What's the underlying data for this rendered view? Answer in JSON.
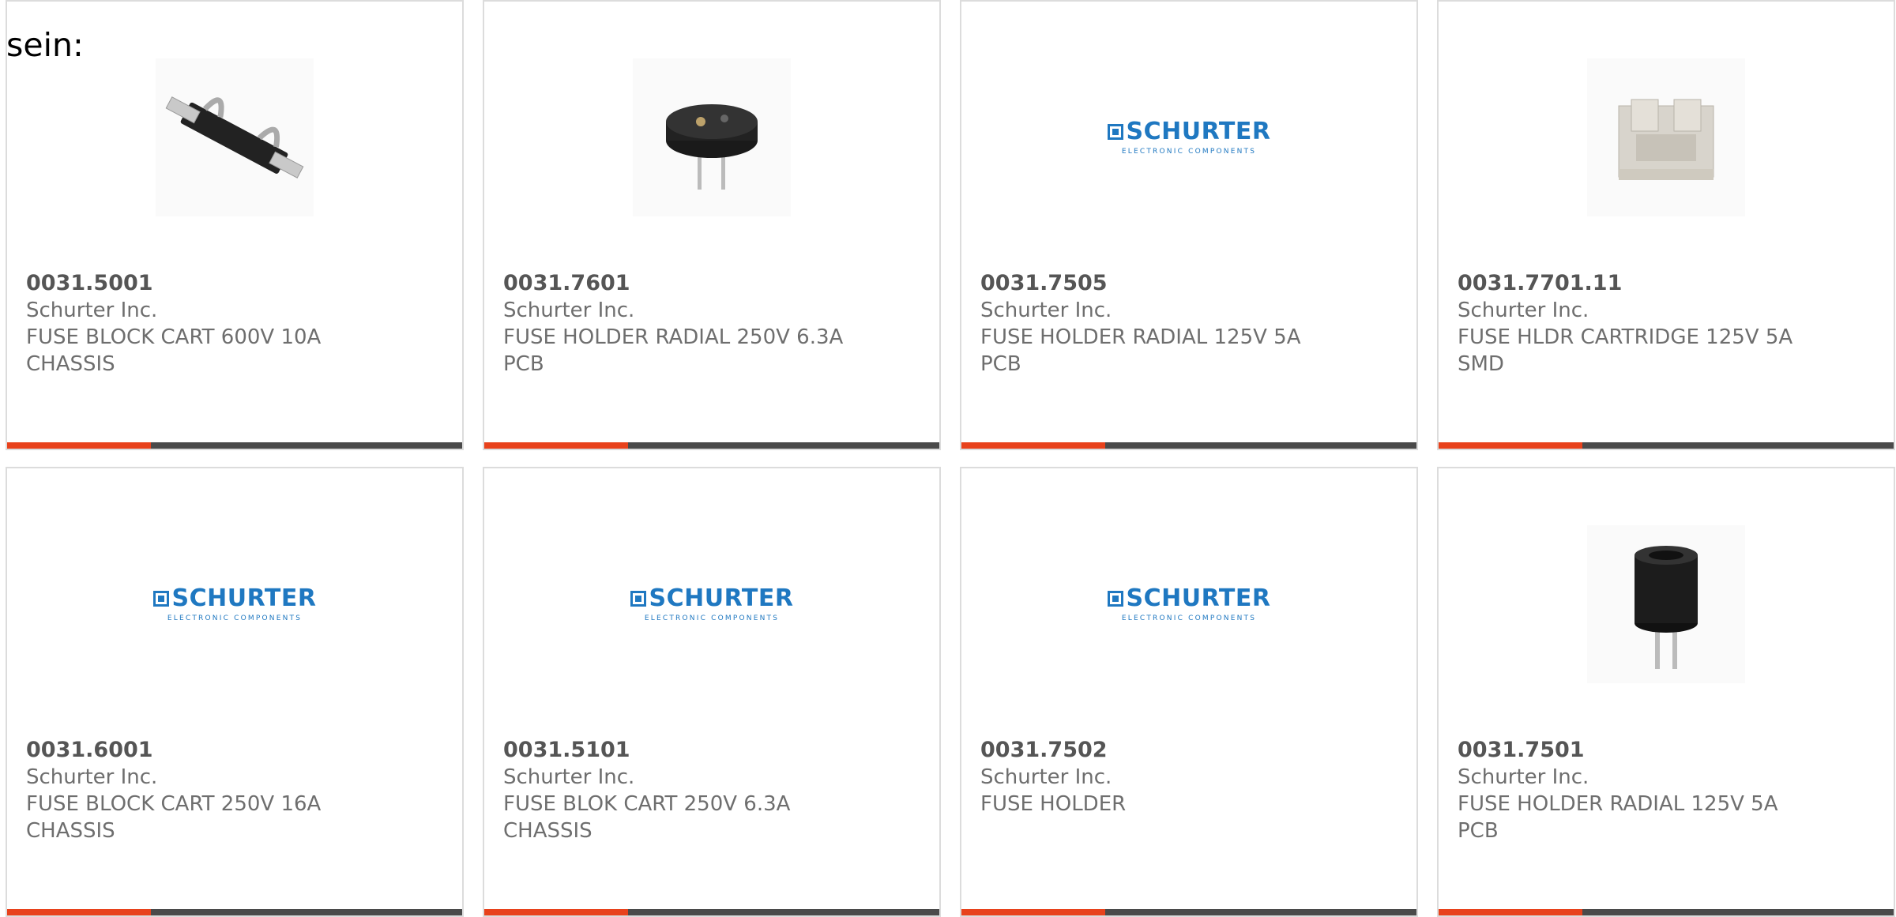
{
  "intro_text": "sein:",
  "products": [
    {
      "part": "0031.5001",
      "maker": "Schurter Inc.",
      "desc1": "FUSE BLOCK CART 600V 10A",
      "desc2": "CHASSIS",
      "image": "fuse-block-photo"
    },
    {
      "part": "0031.7601",
      "maker": "Schurter Inc.",
      "desc1": "FUSE HOLDER RADIAL 250V 6.3A",
      "desc2": "PCB",
      "image": "radial-holder-photo"
    },
    {
      "part": "0031.7505",
      "maker": "Schurter Inc.",
      "desc1": "FUSE HOLDER RADIAL 125V 5A",
      "desc2": "PCB",
      "image": "schurter-logo"
    },
    {
      "part": "0031.7701.11",
      "maker": "Schurter Inc.",
      "desc1": "FUSE HLDR CARTRIDGE 125V 5A",
      "desc2": "SMD",
      "image": "smd-holder-photo"
    },
    {
      "part": "0031.6001",
      "maker": "Schurter Inc.",
      "desc1": "FUSE BLOCK CART 250V 16A",
      "desc2": "CHASSIS",
      "image": "schurter-logo"
    },
    {
      "part": "0031.5101",
      "maker": "Schurter Inc.",
      "desc1": "FUSE BLOK CART 250V 6.3A",
      "desc2": "CHASSIS",
      "image": "schurter-logo"
    },
    {
      "part": "0031.7502",
      "maker": "Schurter Inc.",
      "desc1": "FUSE HOLDER",
      "desc2": "",
      "image": "schurter-logo"
    },
    {
      "part": "0031.7501",
      "maker": "Schurter Inc.",
      "desc1": "FUSE HOLDER RADIAL 125V 5A",
      "desc2": "PCB",
      "image": "cylinder-holder-photo"
    }
  ],
  "logo": {
    "word": "SCHURTER",
    "sub": "ELECTRONIC COMPONENTS"
  },
  "colors": {
    "accent": "#e8421c",
    "bar": "#4a4a4a",
    "logo_blue": "#1f78c1"
  }
}
